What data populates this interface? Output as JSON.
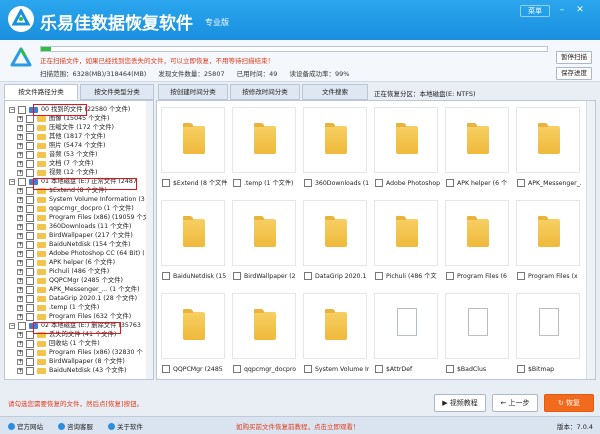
{
  "app": {
    "title": "乐易佳数据恢复软件",
    "edition": "专业版",
    "menu": "菜单"
  },
  "scan": {
    "progress": 0.02,
    "message": "正在扫描文件，如果已经找到您丢失的文件，可以立即恢复，不用等待扫描结束！",
    "range": "扫描范围：6328(MB)/318464(MB)",
    "files_found": "发现文件数量：25807",
    "elapsed": "已用时间：49",
    "read_success": "读设备成功率：99%",
    "pause": "暂停扫描",
    "save_progress": "保存进度"
  },
  "tabs": [
    "按文件路径分类",
    "按文件类型分类",
    "按创建时间分类",
    "按修改时间分类",
    "文件搜索"
  ],
  "current_partition": "正在恢复分区：本地磁盘(E: NTFS)",
  "tree": [
    {
      "label": "00 找到的文件 (22580 个文件)",
      "level": 0,
      "folder": false
    },
    {
      "label": "图像   (15045 个文件)",
      "level": 1,
      "folder": true
    },
    {
      "label": "压缩文件   (172 个文件)",
      "level": 1,
      "folder": true
    },
    {
      "label": "其他   (1817 个文件)",
      "level": 1,
      "folder": true
    },
    {
      "label": "照片   (5474 个文件)",
      "level": 1,
      "folder": true
    },
    {
      "label": "音频   (53 个文件)",
      "level": 1,
      "folder": true
    },
    {
      "label": "文档   (7 个文件)",
      "level": 1,
      "folder": true
    },
    {
      "label": "视频   (12 个文件)",
      "level": 1,
      "folder": true
    },
    {
      "label": "01 本地磁盘 (E:) 正常文件 (2487",
      "level": 0,
      "folder": false
    },
    {
      "label": "$Extend   (8 个文件)",
      "level": 1,
      "folder": true
    },
    {
      "label": "System Volume Information   (3",
      "level": 1,
      "folder": true
    },
    {
      "label": "qqpcmgr_docpro   (1 个文件)",
      "level": 1,
      "folder": true
    },
    {
      "label": "Program Files (x86)   (19059 个文",
      "level": 1,
      "folder": true
    },
    {
      "label": "360Downloads   (11 个文件)",
      "level": 1,
      "folder": true
    },
    {
      "label": "BirdWallpaper   (217 个文件)",
      "level": 1,
      "folder": true
    },
    {
      "label": "BaiduNetdisk   (154 个文件)",
      "level": 1,
      "folder": true
    },
    {
      "label": "Adobe Photoshop CC (64 Bit)   (",
      "level": 1,
      "folder": true
    },
    {
      "label": "APK helper   (6 个文件)",
      "level": 1,
      "folder": true
    },
    {
      "label": "Pichuli   (486 个文件)",
      "level": 1,
      "folder": true
    },
    {
      "label": "QQPCMgr   (2485 个文件)",
      "level": 1,
      "folder": true
    },
    {
      "label": "APK_Messenger_...   (1 个文件)",
      "level": 1,
      "folder": true
    },
    {
      "label": "DataGrip 2020.1   (28 个文件)",
      "level": 1,
      "folder": true
    },
    {
      "label": ".temp   (1 个文件)",
      "level": 1,
      "folder": true
    },
    {
      "label": "Program Files   (632 个文件)",
      "level": 1,
      "folder": true
    },
    {
      "label": "02 本地磁盘 (E:) 删除文件 (35763",
      "level": 0,
      "folder": false
    },
    {
      "label": "丢失的文件   (41 个文件)",
      "level": 1,
      "folder": true
    },
    {
      "label": "回收站   (1 个文件)",
      "level": 1,
      "folder": true
    },
    {
      "label": "Program Files (x86)   (32830 个",
      "level": 1,
      "folder": true
    },
    {
      "label": "BirdWallpaper   (8 个文件)",
      "level": 1,
      "folder": true
    },
    {
      "label": "BaiduNetdisk   (43 个文件)",
      "level": 1,
      "folder": true
    }
  ],
  "grid": [
    {
      "label": "$Extend (8 个文件)",
      "icon": "folder"
    },
    {
      "label": ".temp (1 个文件)",
      "icon": "folder"
    },
    {
      "label": "360Downloads (11",
      "icon": "folder"
    },
    {
      "label": "Adobe Photoshop...",
      "icon": "folder"
    },
    {
      "label": "APK helper (6 个",
      "icon": "folder"
    },
    {
      "label": "APK_Messenger_...",
      "icon": "folder"
    },
    {
      "label": "BaiduNetdisk (15",
      "icon": "folder"
    },
    {
      "label": "BirdWallpaper (2",
      "icon": "folder"
    },
    {
      "label": "DataGrip 2020.1",
      "icon": "folder"
    },
    {
      "label": "Pichuli (486 个文",
      "icon": "folder"
    },
    {
      "label": "Program Files (6",
      "icon": "folder"
    },
    {
      "label": "Program Files (x",
      "icon": "folder"
    },
    {
      "label": "QQPCMgr (2485",
      "icon": "folder"
    },
    {
      "label": "qqpcmgr_docpro",
      "icon": "folder"
    },
    {
      "label": "System Volume In",
      "icon": "folder"
    },
    {
      "label": "$AttrDef",
      "icon": "file"
    },
    {
      "label": "$BadClus",
      "icon": "file"
    },
    {
      "label": "$Bitmap",
      "icon": "file"
    }
  ],
  "bottom": {
    "hint": "请勾选您需要恢复的文件，然后点[恢复]按钮。",
    "video": "视频教程",
    "prev": "上一步",
    "recover": "恢复"
  },
  "footer": {
    "site": "官方网站",
    "consult": "咨询客服",
    "about": "关于软件",
    "promo": "如购买前文件恢复前教程，点击立即观看！",
    "version": "版本：7.0.4"
  }
}
